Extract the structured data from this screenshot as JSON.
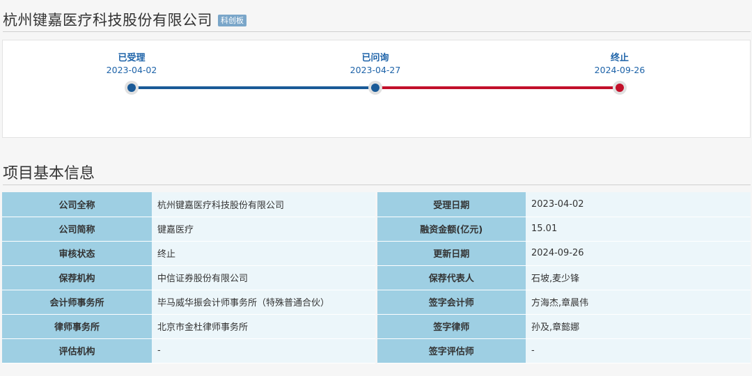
{
  "header": {
    "company_title": "杭州键嘉医疗科技股份有限公司",
    "board_badge": "科创板"
  },
  "timeline": {
    "steps": [
      {
        "name": "已受理",
        "date": "2023-04-02"
      },
      {
        "name": "已问询",
        "date": "2023-04-27"
      },
      {
        "name": "终止",
        "date": "2024-09-26"
      }
    ]
  },
  "section": {
    "title": "项目基本信息"
  },
  "info_rows": [
    {
      "l1": "公司全称",
      "v1": "杭州键嘉医疗科技股份有限公司",
      "l2": "受理日期",
      "v2": "2023-04-02"
    },
    {
      "l1": "公司简称",
      "v1": "键嘉医疗",
      "l2": "融资金额(亿元)",
      "v2": "15.01"
    },
    {
      "l1": "审核状态",
      "v1": "终止",
      "l2": "更新日期",
      "v2": "2024-09-26"
    },
    {
      "l1": "保荐机构",
      "v1": "中信证券股份有限公司",
      "l2": "保荐代表人",
      "v2": "石坡,麦少锋"
    },
    {
      "l1": "会计师事务所",
      "v1": "毕马威华振会计师事务所（特殊普通合伙）",
      "l2": "签字会计师",
      "v2": "方海杰,章晨伟"
    },
    {
      "l1": "律师事务所",
      "v1": "北京市金杜律师事务所",
      "l2": "签字律师",
      "v2": "孙及,章懿娜"
    },
    {
      "l1": "评估机构",
      "v1": "-",
      "l2": "签字评估师",
      "v2": "-"
    }
  ],
  "colors": {
    "blue_track": "#1a5a97",
    "red_track": "#c2102a",
    "label_cell": "#9ecfe3",
    "value_cell": "#ecf6fa"
  }
}
